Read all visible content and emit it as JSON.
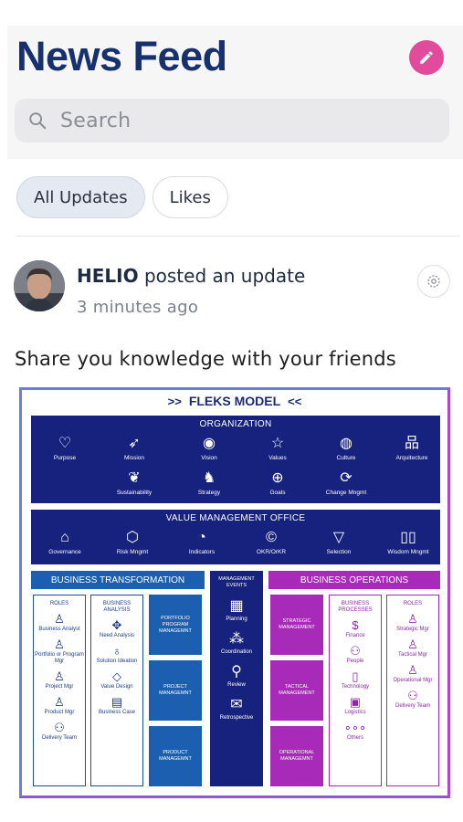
{
  "header": {
    "title": "News Feed",
    "search_placeholder": "Search"
  },
  "tabs": [
    {
      "label": "All Updates",
      "active": true
    },
    {
      "label": "Likes",
      "active": false
    }
  ],
  "post": {
    "author": "HELIO",
    "action": "posted an update",
    "time": "3 minutes ago",
    "text": "Share you knowledge with your friends"
  },
  "fleks": {
    "title": "FLEKS MODEL",
    "organization": {
      "title": "ORGANIZATION",
      "row1": [
        "Purpose",
        "Mission",
        "Vision",
        "Values",
        "Culture",
        "Arquitecture"
      ],
      "row2": [
        "Sustainability",
        "Strategy",
        "Goals",
        "Change Mngmt"
      ]
    },
    "vmo": {
      "title": "VALUE MANAGEMENT OFFICE",
      "items": [
        "Governance",
        "Risk Mngmt",
        "Indicators",
        "OKR/OrKR",
        "Selection",
        "Wisdom Mngmt"
      ]
    },
    "business_transformation": {
      "title": "BUSINESS TRANSFORMATION",
      "roles_head": "ROLES",
      "roles": [
        "Business Analyst",
        "Portfolio or Program Mgr",
        "Project Mgr",
        "Product Mgr",
        "Delivery Team"
      ],
      "analysis_head": "BUSINESS ANALYSIS",
      "analysis": [
        "Need Analysis",
        "Solution Ideation",
        "Value Design",
        "Business Case"
      ],
      "tiles": [
        "PORTFOLIO PROGRAM MANAGEMNT",
        "PROJECT MANAGEMNT",
        "PRODUCT MANAGEMNT"
      ]
    },
    "management_events": {
      "title": "MANAGEMENT EVENTS",
      "items": [
        "Planning",
        "Coordination",
        "Review",
        "Retrospective"
      ]
    },
    "business_operations": {
      "title": "BUSINESS OPERATIONS",
      "tiles": [
        "STRATEGIC MANAGEMENT",
        "TACTICAL MANAGEMENT",
        "OPERATIONAL MANAGEMNT"
      ],
      "processes_head": "BUSINESS PROCESSES",
      "processes": [
        "Finance",
        "People",
        "Technology",
        "Logistics",
        "Others"
      ],
      "roles_head": "ROLES",
      "roles": [
        "Strategic Mgr",
        "Tactical Mgr",
        "Operational Mgr",
        "Delivery Team"
      ]
    }
  },
  "colors": {
    "brand_navy": "#17306e",
    "accent_pink": "#e24a9b",
    "model_navy": "#16227d",
    "model_blue": "#1c5fb0",
    "model_purple": "#a82ab8"
  }
}
